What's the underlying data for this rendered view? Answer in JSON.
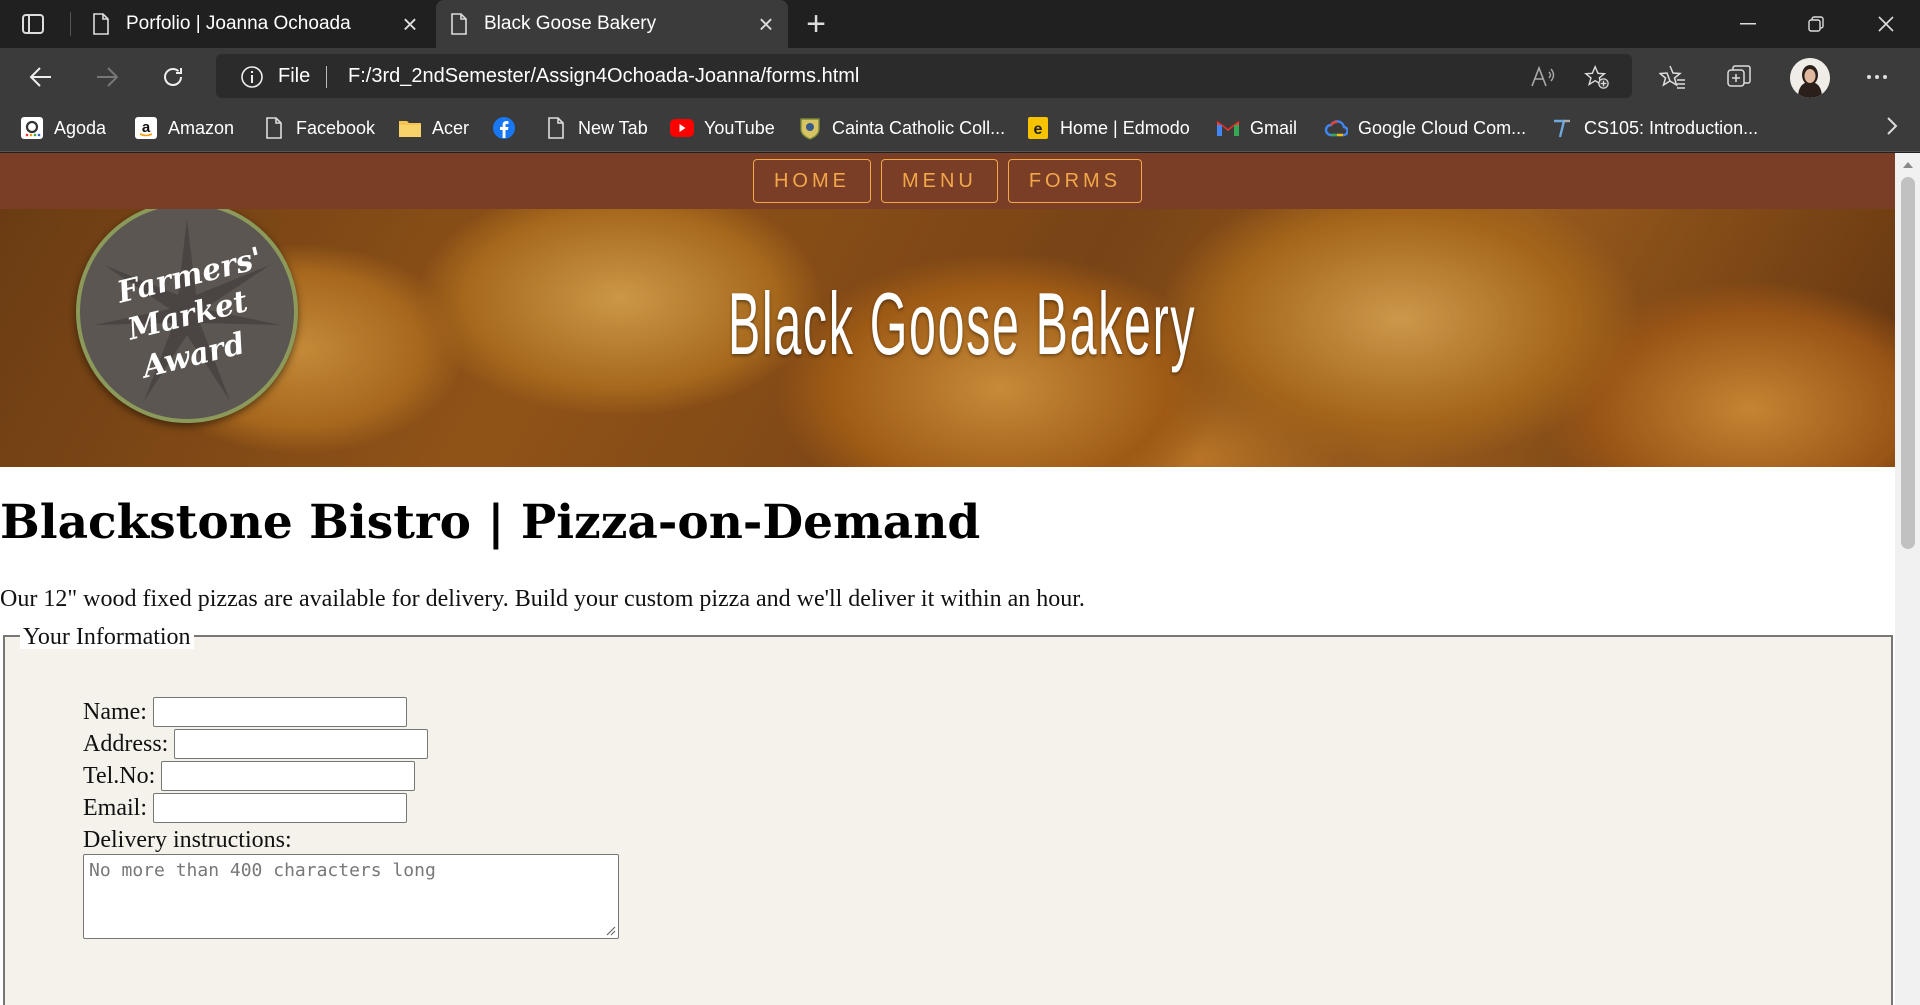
{
  "browser": {
    "tabs": [
      {
        "title": "Porfolio | Joanna Ochoada",
        "active": false
      },
      {
        "title": "Black Goose Bakery",
        "active": true
      }
    ],
    "address": {
      "scheme": "File",
      "url": "F:/3rd_2ndSemester/Assign4Ochoada-Joanna/forms.html"
    },
    "bookmarks": [
      {
        "label": "Agoda",
        "icon": "agoda-icon"
      },
      {
        "label": "Amazon",
        "icon": "amazon-icon"
      },
      {
        "label": "Facebook",
        "icon": "page-icon"
      },
      {
        "label": "Acer",
        "icon": "folder-icon"
      },
      {
        "label": "",
        "icon": "facebook-icon"
      },
      {
        "label": "New Tab",
        "icon": "page-icon"
      },
      {
        "label": "YouTube",
        "icon": "youtube-icon"
      },
      {
        "label": "Cainta Catholic Coll...",
        "icon": "school-icon"
      },
      {
        "label": "Home | Edmodo",
        "icon": "edmodo-icon"
      },
      {
        "label": "Gmail",
        "icon": "gmail-icon"
      },
      {
        "label": "Google Cloud Com...",
        "icon": "google-cloud-icon"
      },
      {
        "label": "CS105: Introduction...",
        "icon": "course-icon"
      }
    ]
  },
  "site": {
    "nav": [
      "HOME",
      "MENU",
      "FORMS"
    ],
    "hero_title": "Black Goose Bakery",
    "badge_text": "Farmers' Market Award",
    "nav_color": "#7a3e26",
    "accent": "#f2a74a"
  },
  "main": {
    "heading": "Blackstone Bistro | Pizza-on-Demand",
    "intro": "Our 12\" wood fixed pizzas are available for delivery. Build your custom pizza and we'll deliver it within an hour.",
    "fieldset_legend": "Your Information",
    "fields": [
      {
        "label": "Name:",
        "value": ""
      },
      {
        "label": "Address:",
        "value": ""
      },
      {
        "label": "Tel.No:",
        "value": ""
      },
      {
        "label": "Email:",
        "value": ""
      }
    ],
    "instructions_label": "Delivery instructions:",
    "instructions_placeholder": "No more than 400 characters long"
  }
}
